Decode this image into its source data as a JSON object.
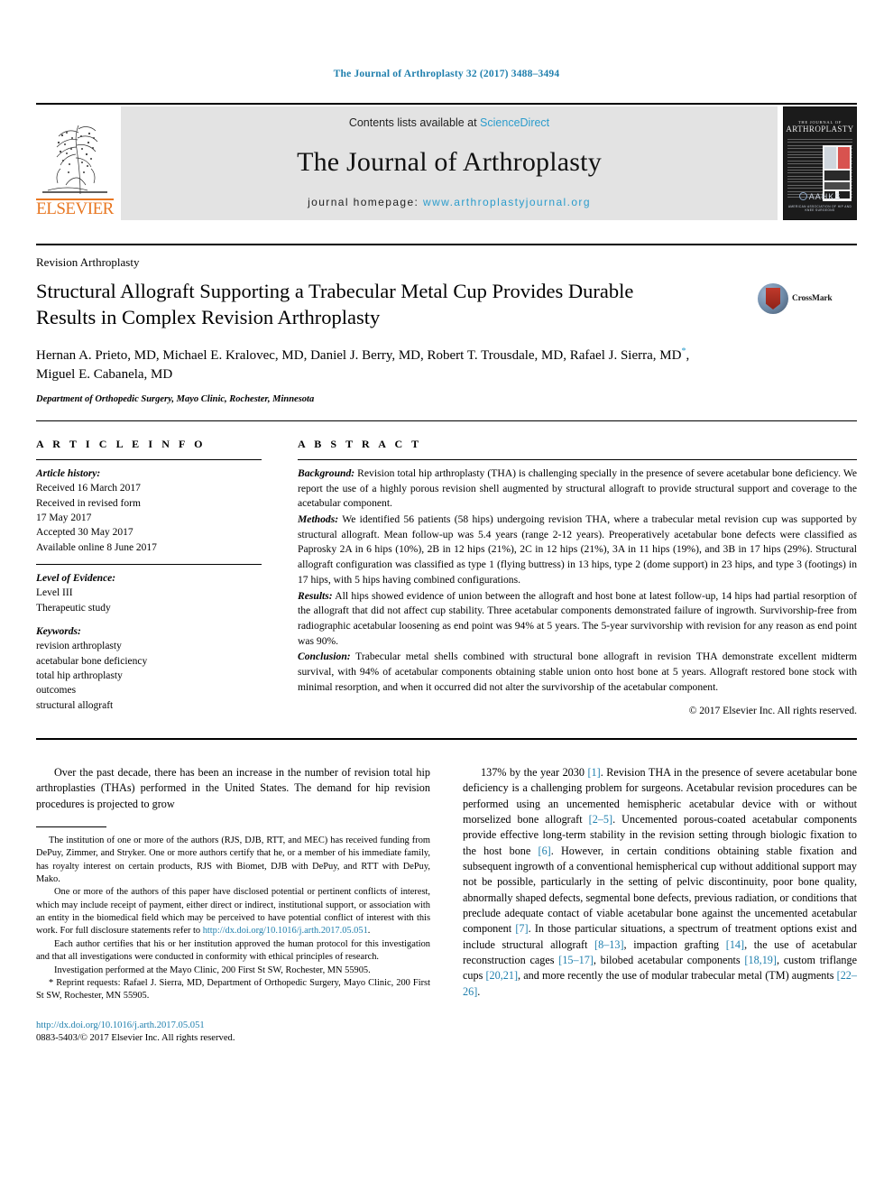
{
  "running_head": "The Journal of Arthroplasty 32 (2017) 3488–3494",
  "masthead": {
    "contents_prefix": "Contents lists available at ",
    "sciencedirect": "ScienceDirect",
    "journal_title": "The Journal of Arthroplasty",
    "homepage_prefix": "journal homepage: ",
    "homepage_url": "www.arthroplastyjournal.org",
    "publisher": "ELSEVIER",
    "cover": {
      "line1": "THE JOURNAL OF",
      "line2": "ARTHROPLASTY",
      "society": "AAHKS",
      "society_sub": "AMERICAN ASSOCIATION OF HIP AND KNEE SURGEONS"
    }
  },
  "article": {
    "section_label": "Revision Arthroplasty",
    "title": "Structural Allograft Supporting a Trabecular Metal Cup Provides Durable Results in Complex Revision Arthroplasty",
    "authors": "Hernan A. Prieto, MD, Michael E. Kralovec, MD, Daniel J. Berry, MD, Robert T. Trousdale, MD, Rafael J. Sierra, MD",
    "authors_tail": ", Miguel E. Cabanela, MD",
    "corresponding_mark": "*",
    "affiliation": "Department of Orthopedic Surgery, Mayo Clinic, Rochester, Minnesota",
    "crossmark_label": "CrossMark"
  },
  "article_info": {
    "heading": "A R T I C L E    I N F O",
    "history_label": "Article history:",
    "history": "Received 16 March 2017\nReceived in revised form\n17 May 2017\nAccepted 30 May 2017\nAvailable online 8 June 2017",
    "evidence_label": "Level of Evidence:",
    "evidence": "Level III\nTherapeutic study",
    "keywords_label": "Keywords:",
    "keywords": "revision arthroplasty\nacetabular bone deficiency\ntotal hip arthroplasty\noutcomes\nstructural allograft"
  },
  "abstract": {
    "heading": "A B S T R A C T",
    "background_label": "Background:",
    "background": " Revision total hip arthroplasty (THA) is challenging specially in the presence of severe acetabular bone deficiency. We report the use of a highly porous revision shell augmented by structural allograft to provide structural support and coverage to the acetabular component.",
    "methods_label": "Methods:",
    "methods": " We identified 56 patients (58 hips) undergoing revision THA, where a trabecular metal revision cup was supported by structural allograft. Mean follow-up was 5.4 years (range 2-12 years). Preoperatively acetabular bone defects were classified as Paprosky 2A in 6 hips (10%), 2B in 12 hips (21%), 2C in 12 hips (21%), 3A in 11 hips (19%), and 3B in 17 hips (29%). Structural allograft configuration was classified as type 1 (flying buttress) in 13 hips, type 2 (dome support) in 23 hips, and type 3 (footings) in 17 hips, with 5 hips having combined configurations.",
    "results_label": "Results:",
    "results": " All hips showed evidence of union between the allograft and host bone at latest follow-up, 14 hips had partial resorption of the allograft that did not affect cup stability. Three acetabular components demonstrated failure of ingrowth. Survivorship-free from radiographic acetabular loosening as end point was 94% at 5 years. The 5-year survivorship with revision for any reason as end point was 90%.",
    "conclusion_label": "Conclusion:",
    "conclusion": " Trabecular metal shells combined with structural bone allograft in revision THA demonstrate excellent midterm survival, with 94% of acetabular components obtaining stable union onto host bone at 5 years. Allograft restored bone stock with minimal resorption, and when it occurred did not alter the survivorship of the acetabular component.",
    "copyright": "© 2017 Elsevier Inc. All rights reserved."
  },
  "body": {
    "left_paragraph": "Over the past decade, there has been an increase in the number of revision total hip arthroplasties (THAs) performed in the United States. The demand for hip revision procedures is projected to grow",
    "right_paragraph_parts": [
      {
        "t": "137% by the year 2030 ",
        "c": false
      },
      {
        "t": "[1]",
        "c": true
      },
      {
        "t": ". Revision THA in the presence of severe acetabular bone deficiency is a challenging problem for surgeons. Acetabular revision procedures can be performed using an uncemented hemispheric acetabular device with or without morselized bone allograft ",
        "c": false
      },
      {
        "t": "[2–5]",
        "c": true
      },
      {
        "t": ". Uncemented porous-coated acetabular components provide effective long-term stability in the revision setting through biologic fixation to the host bone ",
        "c": false
      },
      {
        "t": "[6]",
        "c": true
      },
      {
        "t": ". However, in certain conditions obtaining stable fixation and subsequent ingrowth of a conventional hemispherical cup without additional support may not be possible, particularly in the setting of pelvic discontinuity, poor bone quality, abnormally shaped defects, segmental bone defects, previous radiation, or conditions that preclude adequate contact of viable acetabular bone against the uncemented acetabular component ",
        "c": false
      },
      {
        "t": "[7]",
        "c": true
      },
      {
        "t": ". In those particular situations, a spectrum of treatment options exist and include structural allograft ",
        "c": false
      },
      {
        "t": "[8–13]",
        "c": true
      },
      {
        "t": ", impaction grafting ",
        "c": false
      },
      {
        "t": "[14]",
        "c": true
      },
      {
        "t": ", the use of acetabular reconstruction cages ",
        "c": false
      },
      {
        "t": "[15–17]",
        "c": true
      },
      {
        "t": ", bilobed acetabular components ",
        "c": false
      },
      {
        "t": "[18,19]",
        "c": true
      },
      {
        "t": ", custom triflange cups ",
        "c": false
      },
      {
        "t": "[20,21]",
        "c": true
      },
      {
        "t": ", and more recently the use of modular trabecular metal (TM) augments ",
        "c": false
      },
      {
        "t": "[22–26]",
        "c": true
      },
      {
        "t": ".",
        "c": false
      }
    ]
  },
  "footnotes": {
    "funding": "The institution of one or more of the authors (RJS, DJB, RTT, and MEC) has received funding from DePuy, Zimmer, and Stryker. One or more authors certify that he, or a member of his immediate family, has royalty interest on certain products, RJS with Biomet, DJB with DePuy, and RTT with DePuy, Mako.",
    "conflict_pre": "One or more of the authors of this paper have disclosed potential or pertinent conflicts of interest, which may include receipt of payment, either direct or indirect, institutional support, or association with an entity in the biomedical field which may be perceived to have potential conflict of interest with this work. For full disclosure statements refer to ",
    "conflict_link": "http://dx.doi.org/10.1016/j.arth.2017.05.051",
    "conflict_post": ".",
    "ethics": "Each author certifies that his or her institution approved the human protocol for this investigation and that all investigations were conducted in conformity with ethical principles of research.",
    "investigation": "Investigation performed at the Mayo Clinic, 200 First St SW, Rochester, MN 55905.",
    "reprint_mark": "*",
    "reprint": " Reprint requests: Rafael J. Sierra, MD, Department of Orthopedic Surgery, Mayo Clinic, 200 First St SW, Rochester, MN 55905."
  },
  "footer": {
    "doi": "http://dx.doi.org/10.1016/j.arth.2017.05.051",
    "issn_line": "0883-5403/© 2017 Elsevier Inc. All rights reserved."
  }
}
